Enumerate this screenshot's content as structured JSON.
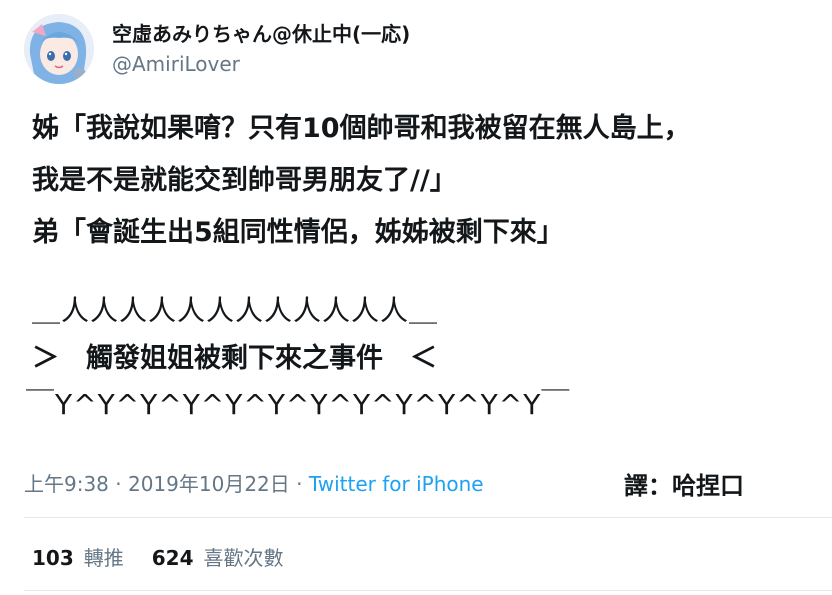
{
  "author": {
    "display_name": "空虛あみりちゃん@休止中(一応)",
    "handle": "@AmiriLover",
    "avatar_icon": "anime-avatar-icon"
  },
  "tweet": {
    "lines": [
      "姊「我說如果唷？只有10個帥哥和我被留在無人島上，",
      "我是不是就能交到帥哥男朋友了//」",
      "弟「會誕生出5組同性情侶，姊姊被剩下來」"
    ],
    "art_top": "＿人人人人人人人人人人人人＿",
    "art_middle": "＞　觸發姐姐被剩下來之事件　＜",
    "art_bottom": "￣Y^Y^Y^Y^Y^Y^Y^Y^Y^Y^Y^Y￣"
  },
  "meta": {
    "time": "上午9:38 · 2019年10月22日 · ",
    "source": "Twitter for iPhone"
  },
  "translator_note": "譯：哈捏口",
  "stats": {
    "retweets_count": "103",
    "retweets_label": "轉推",
    "likes_count": "624",
    "likes_label": "喜歡次數"
  },
  "colors": {
    "text": "#14171a",
    "muted": "#657786",
    "link": "#1da1f2",
    "divider": "#e1e8ed"
  }
}
